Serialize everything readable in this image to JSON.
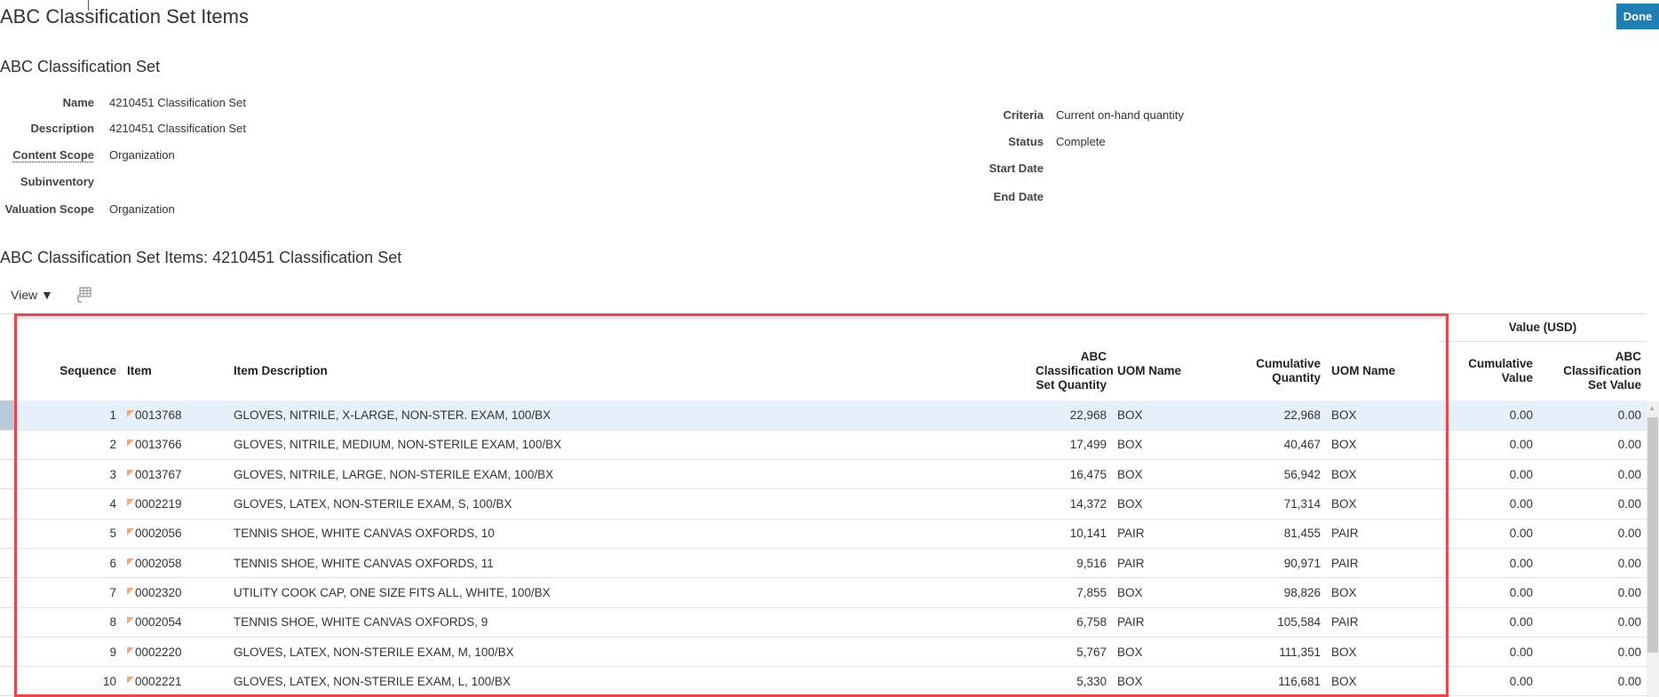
{
  "page": {
    "title": "ABC Classification Set Items",
    "done_label": "Done"
  },
  "set": {
    "header": "ABC Classification Set",
    "left": [
      {
        "label": "Name",
        "value": "4210451 Classification Set"
      },
      {
        "label": "Description",
        "value": "4210451 Classification Set"
      },
      {
        "label": "Content Scope",
        "value": "Organization"
      },
      {
        "label": "Subinventory",
        "value": ""
      },
      {
        "label": "Valuation Scope",
        "value": "Organization"
      }
    ],
    "right": [
      {
        "label": "Criteria",
        "value": "Current on-hand quantity"
      },
      {
        "label": "Status",
        "value": "Complete"
      },
      {
        "label": "Start Date",
        "value": ""
      },
      {
        "label": "End Date",
        "value": ""
      }
    ]
  },
  "items": {
    "title": "ABC Classification Set Items: 4210451 Classification Set",
    "view_label": "View ▼",
    "group_header": "Value (USD)",
    "columns": [
      "Sequence",
      "Item",
      "Item Description",
      "ABC Classification Set Quantity",
      "UOM Name",
      "Cumulative Quantity",
      "UOM Name",
      "Cumulative Value",
      "ABC Classification Set Value"
    ],
    "rows": [
      {
        "seq": "1",
        "item": "0013768",
        "desc": "GLOVES, NITRILE, X-LARGE, NON-STER. EXAM, 100/BX",
        "qty": "22,968",
        "uom": "BOX",
        "cum": "22,968",
        "uom2": "BOX",
        "cumval": "0.00",
        "setval": "0.00"
      },
      {
        "seq": "2",
        "item": "0013766",
        "desc": "GLOVES, NITRILE, MEDIUM, NON-STERILE EXAM, 100/BX",
        "qty": "17,499",
        "uom": "BOX",
        "cum": "40,467",
        "uom2": "BOX",
        "cumval": "0.00",
        "setval": "0.00"
      },
      {
        "seq": "3",
        "item": "0013767",
        "desc": "GLOVES, NITRILE, LARGE, NON-STERILE EXAM, 100/BX",
        "qty": "16,475",
        "uom": "BOX",
        "cum": "56,942",
        "uom2": "BOX",
        "cumval": "0.00",
        "setval": "0.00"
      },
      {
        "seq": "4",
        "item": "0002219",
        "desc": "GLOVES, LATEX, NON-STERILE EXAM, S, 100/BX",
        "qty": "14,372",
        "uom": "BOX",
        "cum": "71,314",
        "uom2": "BOX",
        "cumval": "0.00",
        "setval": "0.00"
      },
      {
        "seq": "5",
        "item": "0002056",
        "desc": "TENNIS SHOE, WHITE CANVAS OXFORDS, 10",
        "qty": "10,141",
        "uom": "PAIR",
        "cum": "81,455",
        "uom2": "PAIR",
        "cumval": "0.00",
        "setval": "0.00"
      },
      {
        "seq": "6",
        "item": "0002058",
        "desc": "TENNIS SHOE, WHITE CANVAS OXFORDS, 11",
        "qty": "9,516",
        "uom": "PAIR",
        "cum": "90,971",
        "uom2": "PAIR",
        "cumval": "0.00",
        "setval": "0.00"
      },
      {
        "seq": "7",
        "item": "0002320",
        "desc": "UTILITY COOK CAP, ONE SIZE FITS ALL, WHITE, 100/BX",
        "qty": "7,855",
        "uom": "BOX",
        "cum": "98,826",
        "uom2": "BOX",
        "cumval": "0.00",
        "setval": "0.00"
      },
      {
        "seq": "8",
        "item": "0002054",
        "desc": "TENNIS SHOE, WHITE CANVAS OXFORDS, 9",
        "qty": "6,758",
        "uom": "PAIR",
        "cum": "105,584",
        "uom2": "PAIR",
        "cumval": "0.00",
        "setval": "0.00"
      },
      {
        "seq": "9",
        "item": "0002220",
        "desc": "GLOVES, LATEX, NON-STERILE EXAM, M, 100/BX",
        "qty": "5,767",
        "uom": "BOX",
        "cum": "111,351",
        "uom2": "BOX",
        "cumval": "0.00",
        "setval": "0.00"
      },
      {
        "seq": "10",
        "item": "0002221",
        "desc": "GLOVES, LATEX, NON-STERILE EXAM, L, 100/BX",
        "qty": "5,330",
        "uom": "BOX",
        "cum": "116,681",
        "uom2": "BOX",
        "cumval": "0.00",
        "setval": "0.00"
      }
    ]
  },
  "colors": {
    "accent": "#1f7fb3",
    "highlight": "#e5484d",
    "selected_row": "#e6f0fb"
  }
}
